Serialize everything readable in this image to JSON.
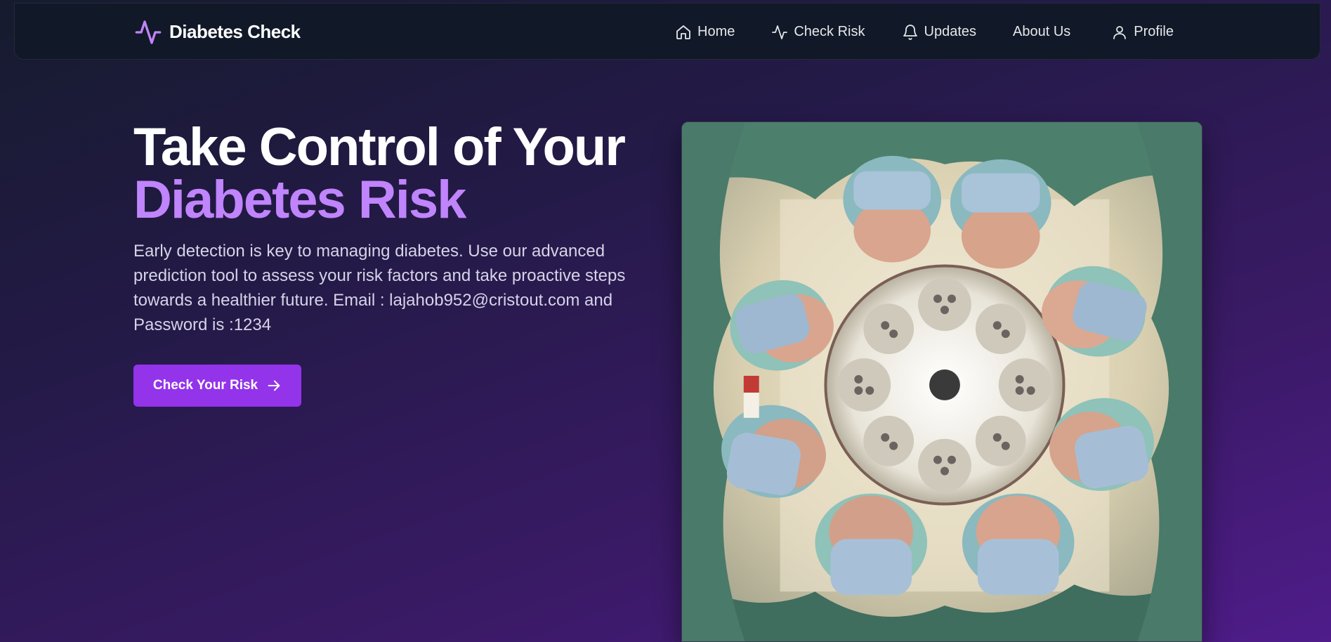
{
  "brand": {
    "name": "Diabetes Check",
    "icon": "activity-icon",
    "accent": "#c084fc"
  },
  "nav": {
    "items": [
      {
        "label": "Home",
        "icon": "home-icon"
      },
      {
        "label": "Check Risk",
        "icon": "activity-icon"
      },
      {
        "label": "Updates",
        "icon": "bell-icon"
      },
      {
        "label": "About Us",
        "icon": ""
      },
      {
        "label": "Profile",
        "icon": "user-icon"
      }
    ]
  },
  "hero": {
    "title_line1": "Take Control of Your",
    "title_line2": "Diabetes Risk",
    "description": "Early detection is key to managing diabetes. Use our advanced prediction tool to assess your risk factors and take proactive steps towards a healthier future. Email : lajahob952@cristout.com and Password is :1234",
    "cta_label": "Check Your Risk",
    "cta_icon": "arrow-right-icon",
    "cta_color": "#9333ea",
    "title_accent": "#c084fc"
  },
  "image": {
    "alt": "Surgeons in masks looking down under an operating light"
  }
}
